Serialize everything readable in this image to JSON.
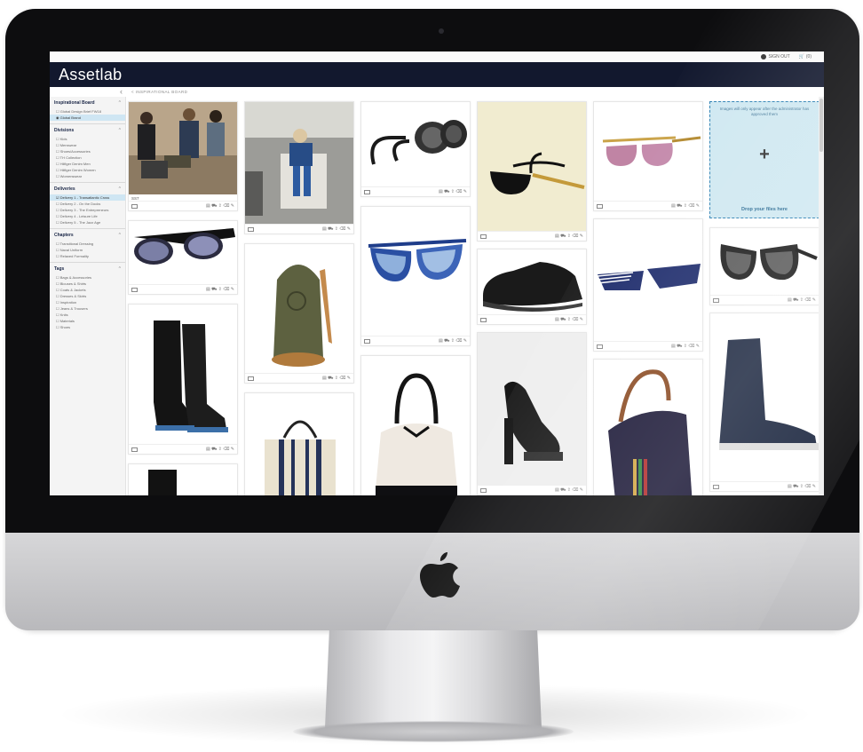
{
  "app": {
    "name": "Assetlab"
  },
  "topbar": {
    "sign_out": "SIGN OUT",
    "cart": "(0)"
  },
  "breadcrumb": "< INSPIRATIONAL BOARD",
  "sidebar": {
    "sections": [
      {
        "title": "Inspirational Board",
        "items": [
          "Global Design Brief FW18",
          "Global Brand"
        ]
      },
      {
        "title": "Divisions",
        "items": [
          "Kids",
          "Menswear",
          "Shoes/Accessories",
          "TH Collection",
          "Hilfiger Denim Men",
          "Hilfiger Denim Women",
          "Womenswear"
        ]
      },
      {
        "title": "Deliveries",
        "items": [
          "Delivery 1 - Transatlantic Cross",
          "Delivery 2 - On the Docks",
          "Delivery 3 - The Entrepreneurs",
          "Delivery 4 - Leisure Life",
          "Delivery 5 - The Jazz Age"
        ]
      },
      {
        "title": "Chapters",
        "items": [
          "Transitional Dressing",
          "Naval Uniform",
          "Relaxed Formality"
        ]
      },
      {
        "title": "Tags",
        "items": [
          "Bags & Accessories",
          "Blouses & Shirts",
          "Coats & Jackets",
          "Dresses & Skirts",
          "Inspiration",
          "Jeans & Trousers",
          "Knits",
          "Materials",
          "Shoes"
        ]
      }
    ]
  },
  "cards": {
    "c1": {
      "caption": "SS7",
      "alt": "Group of people"
    },
    "c2": {
      "alt": "Sunglasses"
    },
    "c3": {
      "alt": "Boots"
    },
    "c4": {
      "alt": "Boot"
    },
    "c5": {
      "alt": "Child on chair"
    },
    "c6": {
      "alt": "Canvas duffel"
    },
    "c7": {
      "alt": "Tote bag"
    },
    "c8": {
      "alt": "Leather goggles"
    },
    "c9": {
      "alt": "Blue aviators"
    },
    "c10": {
      "alt": "Bucket bag"
    },
    "c11": {
      "alt": "Gold sunglasses"
    },
    "c12": {
      "alt": "Derby shoe"
    },
    "c13": {
      "alt": "Heel sandal"
    },
    "c14": {
      "alt": "Round sunglasses"
    },
    "c15": {
      "alt": "Striped wayfarer"
    },
    "c16": {
      "alt": "Handbag"
    },
    "c17": {
      "alt": "Oversized sunglasses"
    },
    "c18": {
      "alt": "Sock boot"
    }
  },
  "upload": {
    "notice": "Images will only appear after the administrator has approved them",
    "plus": "+",
    "drop_label": "Drop your files here"
  },
  "colors": {
    "header": "#12182e",
    "active": "#cfe6f3",
    "drop": "#cfe8f1"
  }
}
